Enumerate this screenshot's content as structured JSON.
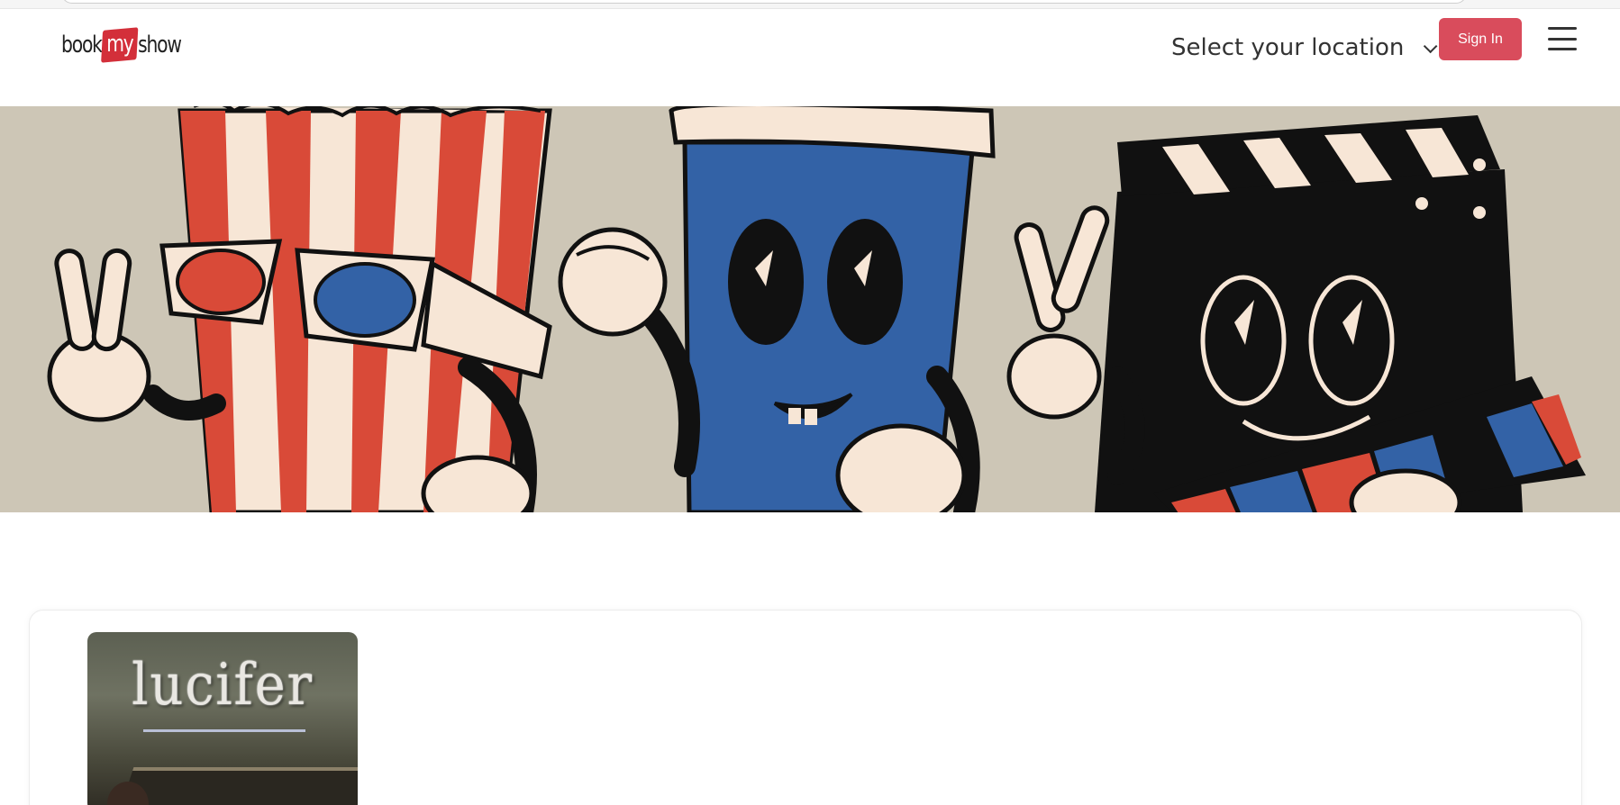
{
  "header": {
    "logo": {
      "part1": "book",
      "part2": "my",
      "part3": "show"
    },
    "location_label": "Select your location",
    "sign_in_label": "Sign In"
  },
  "banner": {
    "characters": [
      "popcorn-bucket",
      "soda-cup",
      "clapperboard"
    ]
  },
  "content": {
    "poster_title": "lucifer"
  },
  "colors": {
    "brand_red": "#d94c5c",
    "banner_bg": "#cdc6b6",
    "popcorn_red": "#d94a38",
    "cup_blue": "#3362a6",
    "cream": "#f7e6d6"
  }
}
